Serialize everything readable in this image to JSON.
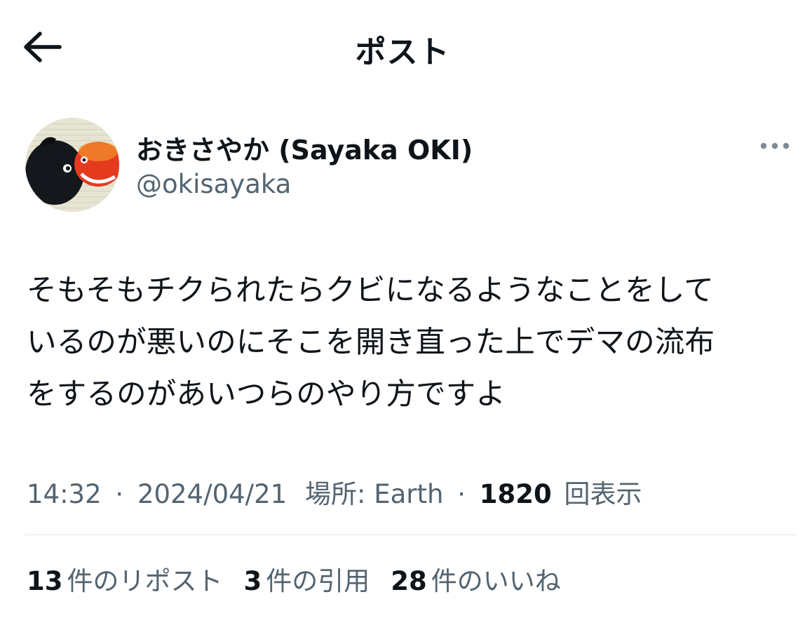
{
  "header": {
    "title": "ポスト"
  },
  "author": {
    "display_name": "おきさやか (Sayaka OKI)",
    "handle": "@okisayaka"
  },
  "tweet": {
    "lines": [
      "そもそもチクられたらクビになるようなことをして",
      "いるのが悪いのにそこを開き直った上でデマの流布",
      "をするのがあいつらのやり方ですよ"
    ]
  },
  "meta": {
    "time": "14:32",
    "date": "2024/04/21",
    "location": "場所: Earth",
    "views_count": "1820",
    "views_label": "回表示",
    "separator": "·"
  },
  "stats": {
    "reposts": {
      "count": "13",
      "label": "件のリポスト"
    },
    "quotes": {
      "count": "3",
      "label": "件の引用"
    },
    "likes": {
      "count": "28",
      "label": "件のいいね"
    }
  },
  "colors": {
    "text": "#0f1419",
    "secondary": "#536471",
    "divider": "#dfe3e6"
  },
  "icons": {
    "back": "arrow-left-icon",
    "more": "more-horizontal-icon"
  }
}
